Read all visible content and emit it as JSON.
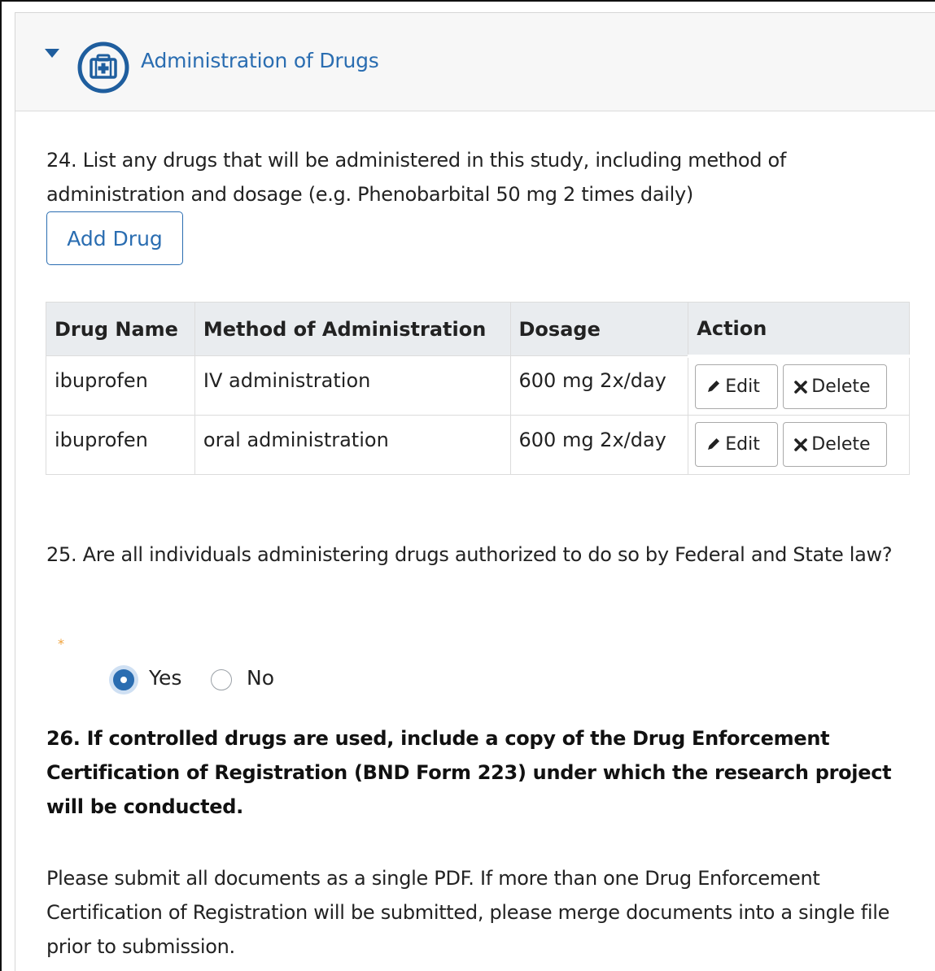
{
  "section": {
    "title": "Administration of Drugs",
    "icon": "medical-kit-icon",
    "expanded": true
  },
  "q24": {
    "text": "24. List any drugs that will be administered in this study, including method of administration and dosage (e.g. Phenobarbital 50 mg 2 times daily)",
    "add_button_label": "Add Drug"
  },
  "table": {
    "headers": [
      "Drug Name",
      "Method of Administration",
      "Dosage",
      "Action"
    ],
    "rows": [
      {
        "drug": "ibuprofen",
        "method": "IV administration",
        "dosage": "600 mg 2x/day",
        "edit_label": "Edit",
        "delete_label": "Delete"
      },
      {
        "drug": "ibuprofen",
        "method": "oral administration",
        "dosage": "600 mg 2x/day",
        "edit_label": "Edit",
        "delete_label": "Delete"
      }
    ]
  },
  "q25": {
    "text": "25. Are all individuals administering drugs authorized to do so by Federal and State law?",
    "required_marker": "*",
    "options": [
      {
        "label": "Yes",
        "selected": true
      },
      {
        "label": "No",
        "selected": false
      }
    ]
  },
  "q26": {
    "text": "26. If controlled drugs are used, include a copy of the Drug Enforcement Certification of Registration (BND Form 223) under which the research project will be conducted.",
    "note": "Please submit all documents as a single PDF. If more than one Drug Enforcement Certification of Registration will be submitted, please merge documents into a single file prior to submission."
  },
  "colors": {
    "accent": "#2a6db1",
    "header_bg": "#f7f7f7",
    "table_header_bg": "#e9ecef",
    "required": "#f0a23a"
  }
}
